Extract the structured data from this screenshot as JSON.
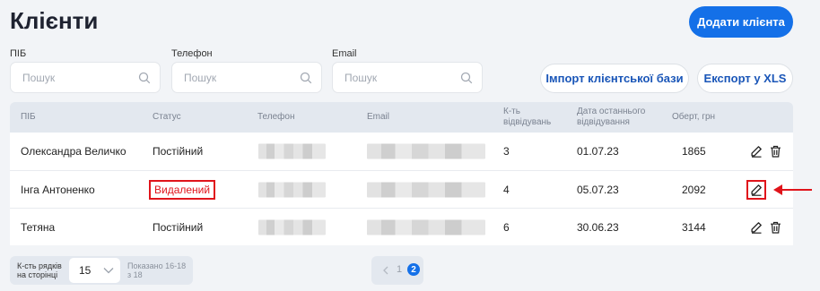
{
  "page": {
    "title": "Клієнти",
    "add_button": "Додати клієнта"
  },
  "filters": {
    "name_label": "ПІБ",
    "phone_label": "Телефон",
    "email_label": "Email",
    "placeholder": "Пошук",
    "import_button": "Імпорт клієнтської бази",
    "export_button": "Експорт у XLS"
  },
  "table": {
    "headers": {
      "name": "ПІБ",
      "status": "Статус",
      "phone": "Телефон",
      "email": "Email",
      "visits_1": "К-ть",
      "visits_2": "відвідувань",
      "last_1": "Дата останнього",
      "last_2": "відвідування",
      "turnover": "Оберт, грн"
    },
    "rows": [
      {
        "name": "Олександра Величко",
        "status": "Постійний",
        "visits": "3",
        "last_visit": "01.07.23",
        "turnover": "1865"
      },
      {
        "name": "Інга Антоненко",
        "status": "Видалений",
        "visits": "4",
        "last_visit": "05.07.23",
        "turnover": "2092"
      },
      {
        "name": "Тетяна",
        "status": "Постійний",
        "visits": "6",
        "last_visit": "30.06.23",
        "turnover": "3144"
      }
    ]
  },
  "footer": {
    "rows_label_1": "К-сть рядків",
    "rows_label_2": "на сторінці",
    "rows_value": "15",
    "shown_1": "Показано 16-18",
    "shown_2": "з 18",
    "page_1": "1",
    "page_2": "2",
    "current_page": 2
  },
  "colors": {
    "primary": "#1470e8",
    "deleted_status": "#e0141b",
    "annotation": "#e0141b"
  },
  "icons": [
    "search-icon",
    "edit-icon",
    "trash-icon",
    "chevron-down-icon",
    "chevron-left-icon",
    "arrow-left-icon"
  ]
}
